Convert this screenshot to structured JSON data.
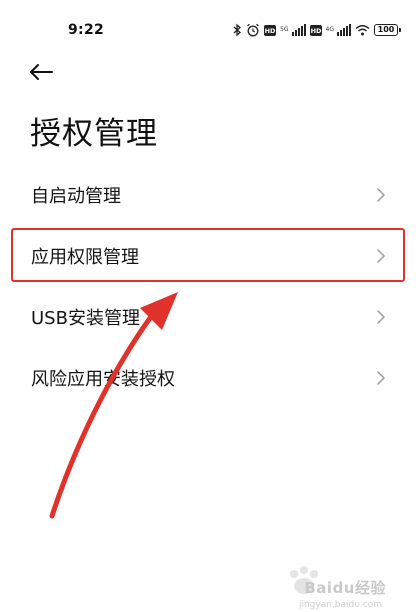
{
  "status_bar": {
    "time": "9:22",
    "icons": [
      "bluetooth-icon",
      "alarm-icon",
      "hd-icon",
      "signal-5g-icon",
      "hd-icon",
      "signal-4g-icon",
      "wifi-icon",
      "battery-icon"
    ],
    "signal_label_1": "5G",
    "signal_label_2": "4G",
    "battery_level": "100"
  },
  "header": {
    "title": "授权管理"
  },
  "menu": {
    "items": [
      {
        "label": "自启动管理",
        "highlighted": false
      },
      {
        "label": "应用权限管理",
        "highlighted": true
      },
      {
        "label": "USB安装管理",
        "highlighted": false
      },
      {
        "label": "风险应用安装授权",
        "highlighted": false
      }
    ]
  },
  "annotation": {
    "color": "#e0322a"
  },
  "watermark": {
    "text": "Baidu经验",
    "sub": "jingyan.baidu.com"
  }
}
